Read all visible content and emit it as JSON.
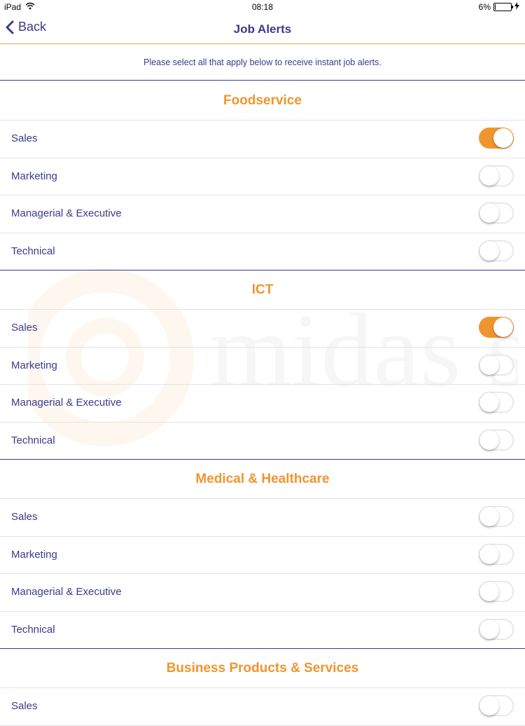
{
  "status_bar": {
    "device": "iPad",
    "time": "08:18",
    "battery_text": "6%",
    "battery_level": 0.06
  },
  "nav": {
    "back_label": "Back",
    "title": "Job Alerts"
  },
  "instructions": "Please select all that apply below to receive instant job alerts.",
  "colors": {
    "accent": "#f0952e",
    "text": "#3a3a8c",
    "divider": "#e3e3e3"
  },
  "watermark_text": "midas selection",
  "sections": [
    {
      "title": "Foodservice",
      "items": [
        {
          "label": "Sales",
          "on": true
        },
        {
          "label": "Marketing",
          "on": false
        },
        {
          "label": "Managerial & Executive",
          "on": false
        },
        {
          "label": "Technical",
          "on": false
        }
      ]
    },
    {
      "title": "ICT",
      "items": [
        {
          "label": "Sales",
          "on": true
        },
        {
          "label": "Marketing",
          "on": false
        },
        {
          "label": "Managerial & Executive",
          "on": false
        },
        {
          "label": "Technical",
          "on": false
        }
      ]
    },
    {
      "title": "Medical & Healthcare",
      "items": [
        {
          "label": "Sales",
          "on": false
        },
        {
          "label": "Marketing",
          "on": false
        },
        {
          "label": "Managerial & Executive",
          "on": false
        },
        {
          "label": "Technical",
          "on": false
        }
      ]
    },
    {
      "title": "Business Products & Services",
      "items": [
        {
          "label": "Sales",
          "on": false
        }
      ]
    }
  ]
}
